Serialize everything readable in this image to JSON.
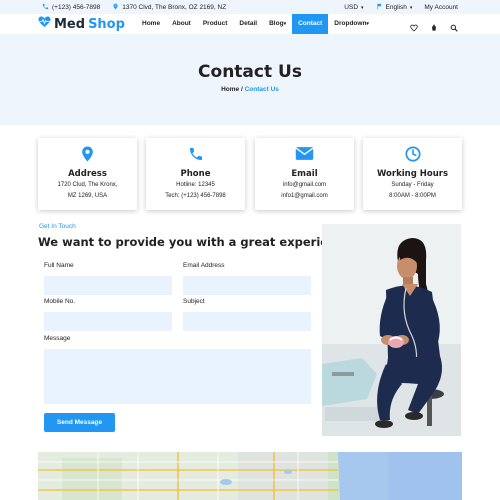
{
  "topbar": {
    "phone": "(+123) 456-7898",
    "address": "1370 Clvd, The Bronx, OZ 2169, NZ",
    "currency": "USD",
    "language": "English",
    "account": "My Account"
  },
  "header": {
    "logo_part1": "Med",
    "logo_part2": "Shop",
    "nav": [
      "Home",
      "About",
      "Product",
      "Detail",
      "Blog",
      "Contact",
      "Dropdown"
    ],
    "active_nav": "Contact"
  },
  "banner": {
    "title": "Contact Us",
    "crumb_home": "Home",
    "crumb_sep": "/",
    "crumb_current": "Contact Us"
  },
  "cards": [
    {
      "title": "Address",
      "line1": "1720 Clud, The Kronx,",
      "line2": "MZ 1269, USA",
      "icon": "map-pin-icon"
    },
    {
      "title": "Phone",
      "line1": "Hotline: 12345",
      "line2": "Tech: (+123) 456-7898",
      "icon": "phone-icon"
    },
    {
      "title": "Email",
      "line1": "info@gmail.com",
      "line2": "info1@gmail.com",
      "icon": "email-icon"
    },
    {
      "title": "Working Hours",
      "line1": "Sunday - Friday",
      "line2": "8:00AM - 8:00PM",
      "icon": "clock-icon"
    }
  ],
  "form": {
    "eyebrow": "Get In Touch",
    "heading": "We want to provide you with a great experience",
    "full_name_label": "Full Name",
    "email_label": "Email Address",
    "mobile_label": "Mobile No.",
    "subject_label": "Subject",
    "message_label": "Message",
    "send_label": "Send Message"
  },
  "colors": {
    "accent": "#2196f3",
    "light_bg": "#eef5fc",
    "input_bg": "#e9f3fd",
    "dark_text": "#222222"
  }
}
